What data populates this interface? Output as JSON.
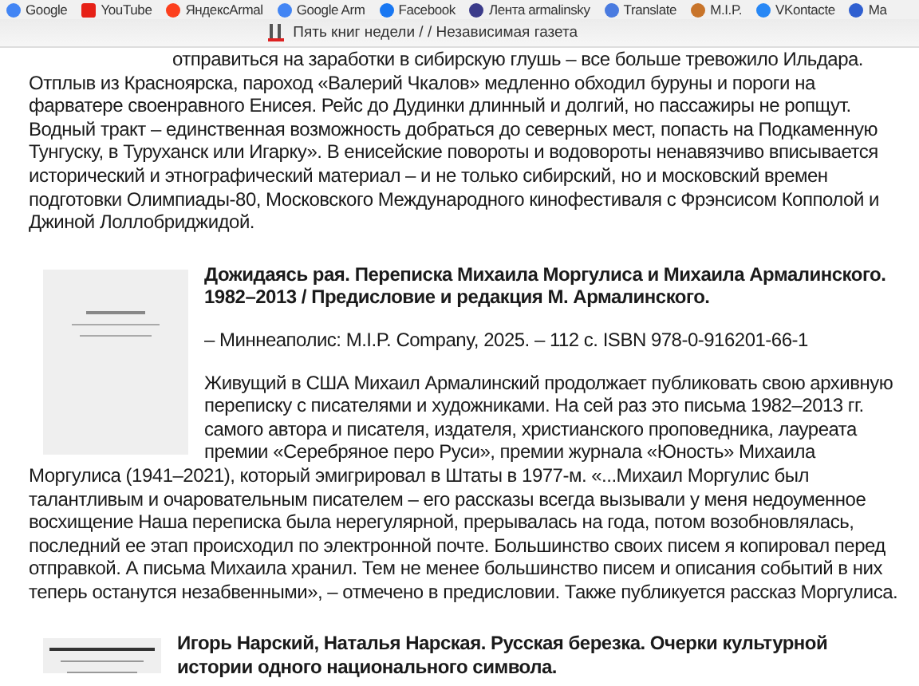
{
  "bookmarks": [
    {
      "label": "Google",
      "kind": "google"
    },
    {
      "label": "YouTube",
      "kind": "youtube"
    },
    {
      "label": "ЯндексArmal",
      "kind": "yandex"
    },
    {
      "label": "Google Arm",
      "kind": "google"
    },
    {
      "label": "Facebook",
      "kind": "facebook"
    },
    {
      "label": "Лента armalinsky",
      "kind": "person"
    },
    {
      "label": "Translate",
      "kind": "translate"
    },
    {
      "label": "M.I.P.",
      "kind": "mip"
    },
    {
      "label": "VKontacte",
      "kind": "vk"
    },
    {
      "label": "Ma",
      "kind": "mail"
    }
  ],
  "tab": {
    "title": "Пять книг недели / / Независимая газета"
  },
  "intro": {
    "first_line": "отправиться на заработки в сибирскую глушь – все больше тревожило Ильдара.",
    "text": "Отплыв из Красноярска, пароход «Валерий Чкалов» медленно обходил буруны и пороги на фарватере своенравного Енисея. Рейс до Дудинки длинный и долгий, но пассажиры не ропщут. Водный тракт – единственная возможность добраться до северных мест, попасть на Подкаменную Тунгуску, в Туруханск или Игарку». В енисейские повороты и водовороты ненавязчиво вписывается исторический и этнографический материал – и не только сибирский, но и московский  времен подготовки Олимпиады-80, Московского Международного кинофестиваля с Фрэнсисом Копполой и Джиной Лоллобриджидой."
  },
  "books": [
    {
      "kind": "light",
      "title": "Дожидаясь рая. Переписка Михаила Моргулиса и Михаила Армалинского. 1982–2013 / Предисловие и редакция М. Армалинского.",
      "imprint": "– Миннеаполис: M.I.P. Company, 2025. – 112 с. ISBN 978-0-916201-66-1",
      "review": "Живущий в США Михаил Армалинский продолжает публиковать свою архивную переписку с писателями и художниками. На сей раз это письма 1982–2013 гг. самого автора и писателя, издателя, христианского проповедника, лауреата премии «Серебряное перо Руси», премии журнала «Юность» Михаила Моргулиса (1941–2021), который эмигрировал в Штаты в 1977-м. «...Михаил Моргулис был талантливым и очаровательным писателем – его рассказы всегда вызывали у меня недоуменное восхищение  Наша переписка была нерегулярной, прерывалась на года, потом возобновлялась, последний ее этап происходил по электронной почте. Большинство своих писем я копировал перед отправкой. А письма Михаила хранил. Тем не менее большинство писем и описания событий в них теперь останутся незабвенными», – отмечено в предисловии. Также публикуется рассказ Моргулиса."
    },
    {
      "kind": "banded",
      "title": "Игорь Нарский, Наталья Нарская. Русская березка. Очерки культурной истории одного национального символа."
    }
  ]
}
